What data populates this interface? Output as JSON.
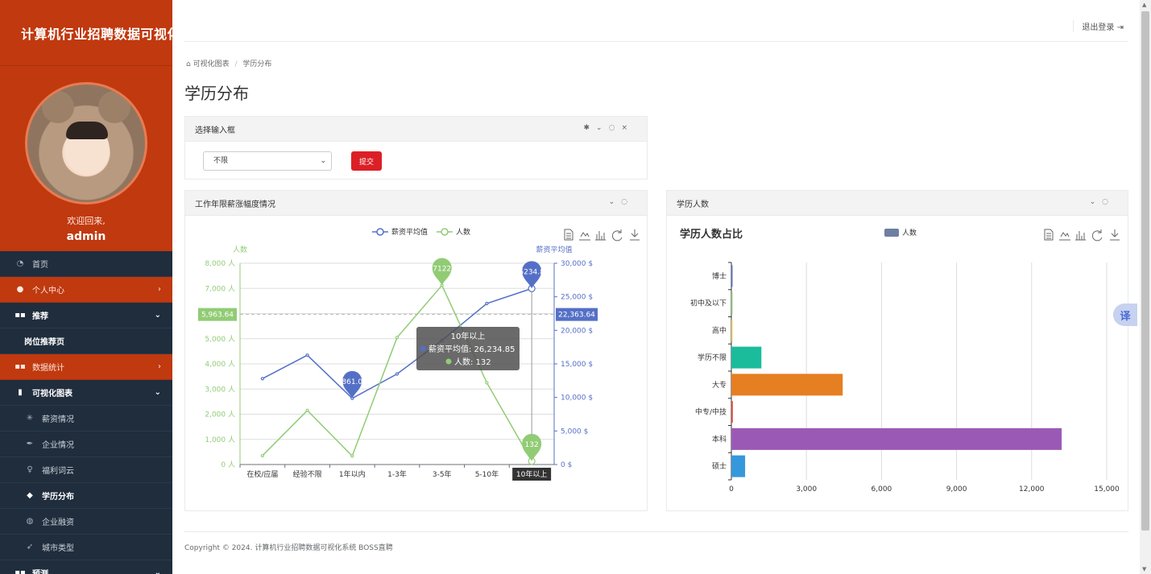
{
  "sidebar": {
    "system_title": "计算机行业招聘数据可视化",
    "welcome": "欢迎回来,",
    "username": "admin",
    "menu": [
      {
        "label": "首页",
        "icon": "dashboard-icon",
        "glyph": "◔"
      },
      {
        "label": "个人中心",
        "icon": "user-icon",
        "glyph": "●"
      },
      {
        "label": "推荐",
        "icon": "grid-icon",
        "glyph": "▪▪"
      },
      {
        "label": "岗位推荐页"
      },
      {
        "label": "数据统计",
        "icon": "grid-icon",
        "glyph": "▪▪"
      },
      {
        "label": "可视化图表",
        "icon": "bar-chart-icon",
        "glyph": "▮"
      },
      {
        "label": "薪资情况",
        "icon": "asterisk-icon",
        "glyph": "✳"
      },
      {
        "label": "企业情况",
        "icon": "feather-icon",
        "glyph": "✒"
      },
      {
        "label": "福利词云",
        "icon": "lightbulb-icon",
        "glyph": "♀"
      },
      {
        "label": "学历分布",
        "icon": "graduation-cap-icon",
        "glyph": "◆"
      },
      {
        "label": "企业融资",
        "icon": "globe-icon",
        "glyph": "◍"
      },
      {
        "label": "城市类型",
        "icon": "rocket-icon",
        "glyph": "➶"
      },
      {
        "label": "预测",
        "icon": "grid-icon",
        "glyph": "▪▪"
      }
    ]
  },
  "header": {
    "logout_label": "退出登录",
    "logout_icon": "sign-out-icon"
  },
  "breadcrumb": {
    "home": "可视化图表",
    "current": "学历分布"
  },
  "page_title": "学历分布",
  "select_panel": {
    "title": "选择输入框",
    "select_value": "不限",
    "submit_label": "提交"
  },
  "chart_data": [
    {
      "type": "line",
      "panel_title": "工作年限薪涨幅度情况",
      "categories": [
        "在校/应届",
        "经验不限",
        "1年以内",
        "1-3年",
        "3-5年",
        "5-10年",
        "10年以上"
      ],
      "series": [
        {
          "name": "薪资平均值",
          "axis": "right",
          "color": "#5470c6",
          "values": [
            12800,
            16300,
            9861.04,
            13500,
            18500,
            24000,
            26234.85
          ]
        },
        {
          "name": "人数",
          "axis": "left",
          "color": "#91cc75",
          "values": [
            350,
            2150,
            340,
            5050,
            7122,
            3250,
            132
          ]
        }
      ],
      "left_axis": {
        "name": "人数",
        "min": 0,
        "max": 8000,
        "ticks": [
          "0 人",
          "1,000 人",
          "2,000 人",
          "3,000 人",
          "4,000 人",
          "5,000 人",
          "6,000 人",
          "7,000 人",
          "8,000 人"
        ]
      },
      "right_axis": {
        "name": "薪资平均值",
        "min": 0,
        "max": 30000,
        "ticks": [
          "0 $",
          "5,000 $",
          "10,000 $",
          "15,000 $",
          "20,000 $",
          "25,000 $",
          "30,000 $"
        ]
      },
      "mark_points": [
        {
          "series": 0,
          "index": 2,
          "label": "9861.04"
        },
        {
          "series": 0,
          "index": 6,
          "label": "26234.85"
        },
        {
          "series": 1,
          "index": 4,
          "label": "7122"
        },
        {
          "series": 1,
          "index": 6,
          "label": "132"
        }
      ],
      "mark_lines": {
        "left": "5,963.64",
        "right": "22,363.64"
      },
      "tooltip": {
        "title": "10年以上",
        "line1": "薪资平均值: 26,234.85",
        "line2": "人数: 132"
      },
      "highlight_category": "10年以上"
    },
    {
      "type": "bar",
      "orientation": "horizontal",
      "panel_title": "学历人数",
      "title": "学历人数占比",
      "legend": "人数",
      "categories": [
        "博士",
        "初中及以下",
        "高中",
        "学历不限",
        "大专",
        "中专/中技",
        "本科",
        "硕士"
      ],
      "values": [
        5,
        10,
        30,
        1200,
        4450,
        60,
        13200,
        550
      ],
      "colors": [
        "#5470c6",
        "#91cc75",
        "#fac858",
        "#1abc9c",
        "#e67e22",
        "#e74c3c",
        "#9b59b6",
        "#3498db"
      ],
      "x_ticks": [
        "0",
        "3,000",
        "6,000",
        "9,000",
        "12,000",
        "15,000"
      ],
      "xlim": [
        0,
        15000
      ]
    }
  ],
  "footer": {
    "copyright": "Copyright © 2024. 计算机行业招聘数据可视化系统 BOSS直聘"
  },
  "translate_label": "译"
}
